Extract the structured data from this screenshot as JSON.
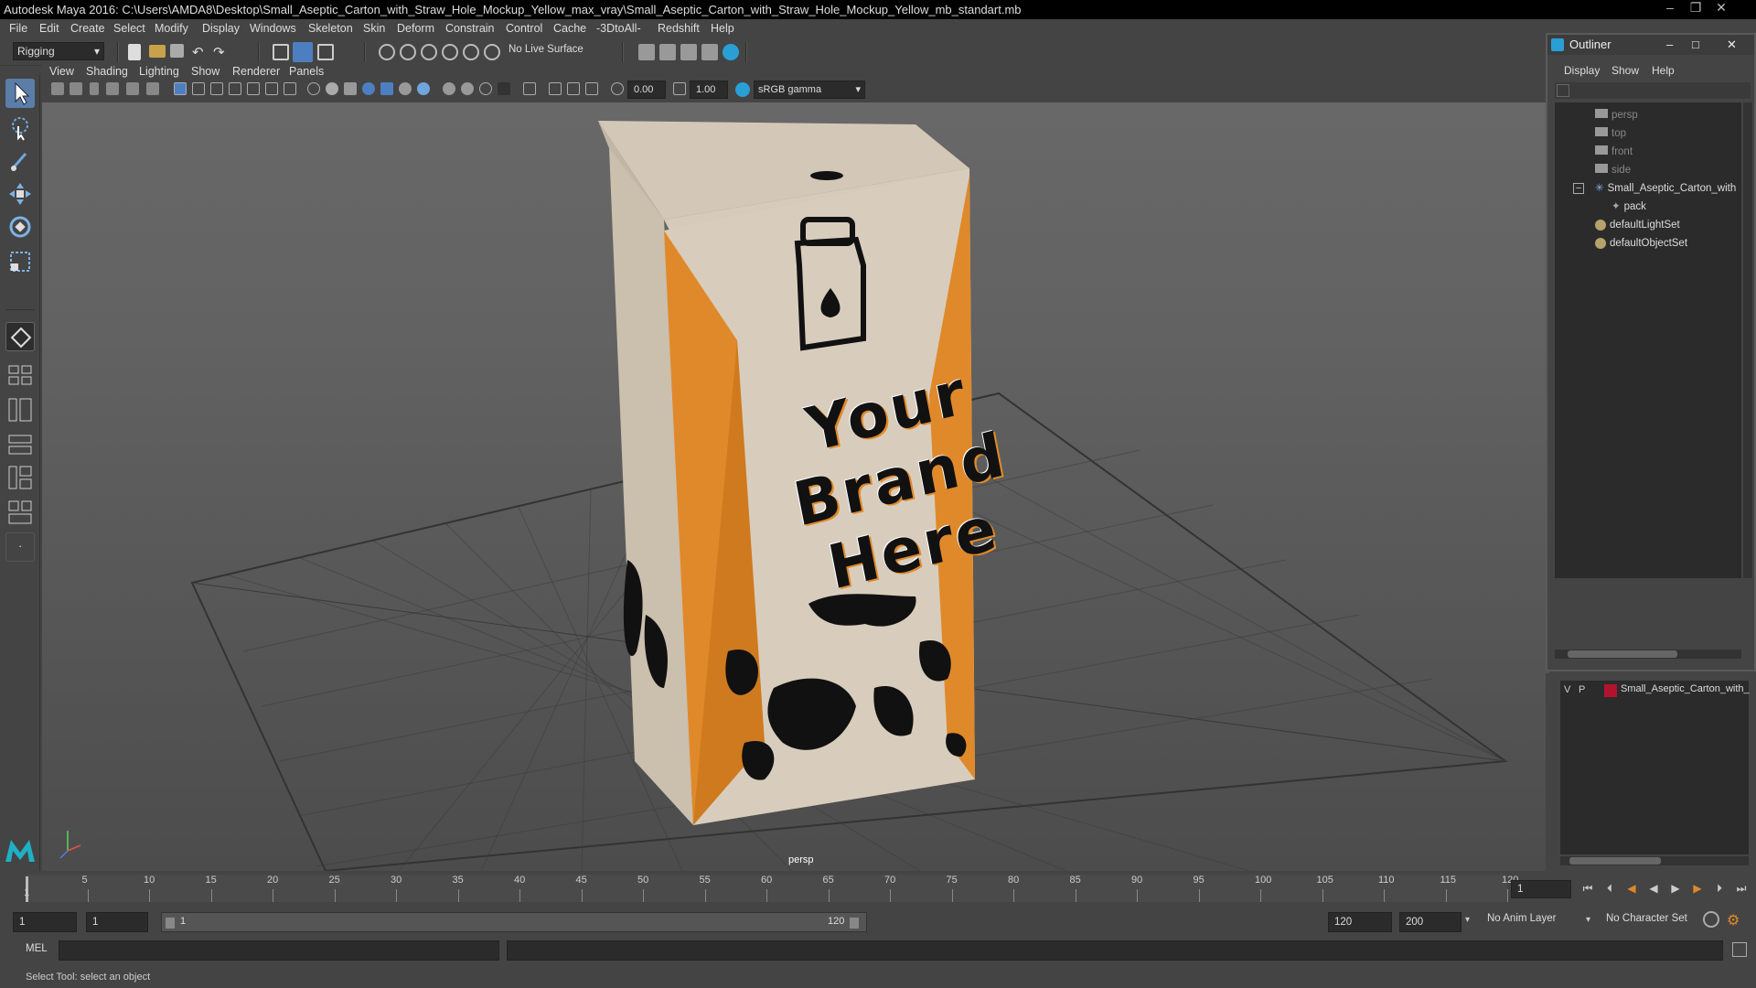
{
  "window": {
    "title": "Autodesk Maya 2016: C:\\Users\\AMDA8\\Desktop\\Small_Aseptic_Carton_with_Straw_Hole_Mockup_Yellow_max_vray\\Small_Aseptic_Carton_with_Straw_Hole_Mockup_Yellow_mb_standart.mb"
  },
  "menubar": {
    "items": [
      "File",
      "Edit",
      "Create",
      "Select",
      "Modify",
      "Display",
      "Windows",
      "Skeleton",
      "Skin",
      "Deform",
      "Constrain",
      "Control",
      "Cache",
      "-3DtoAll-",
      "Redshift",
      "Help"
    ]
  },
  "shelf": {
    "mode": "Rigging",
    "live_surface": "No Live Surface"
  },
  "panel_menu": {
    "items": [
      "View",
      "Shading",
      "Lighting",
      "Show",
      "Renderer",
      "Panels"
    ]
  },
  "panel_toolbar": {
    "exposure": "0.00",
    "gamma": "1.00",
    "color_space": "sRGB gamma"
  },
  "viewport": {
    "camera_label": "persp",
    "carton_text": [
      "Your",
      "Brand",
      "Here"
    ]
  },
  "outliner": {
    "title": "Outliner",
    "menu": [
      "Display",
      "Show",
      "Help"
    ],
    "items": [
      "persp",
      "top",
      "front",
      "side",
      "Small_Aseptic_Carton_with",
      "pack",
      "defaultLightSet",
      "defaultObjectSet"
    ]
  },
  "layer_editor": {
    "v": "V",
    "p": "P",
    "layer_name": "Small_Aseptic_Carton_with_"
  },
  "timeline": {
    "ticks": [
      "5",
      "10",
      "15",
      "20",
      "25",
      "30",
      "35",
      "40",
      "45",
      "50",
      "55",
      "60",
      "65",
      "70",
      "75",
      "80",
      "85",
      "90",
      "95",
      "100",
      "105",
      "110",
      "115",
      "120"
    ],
    "start_marker": "1",
    "current_frame": "1"
  },
  "range": {
    "start": "1",
    "playback_start": "1",
    "slider_start": "1",
    "slider_end": "120",
    "playback_end": "120",
    "end": "200",
    "anim_layer": "No Anim Layer",
    "character_set": "No Character Set"
  },
  "command": {
    "label": "MEL"
  },
  "help_line": {
    "text": "Select Tool: select an object"
  },
  "colors": {
    "bg": "#444444",
    "field": "#2b2b2b",
    "accent": "#4d7fc0",
    "carton_orange": "#e0892a",
    "carton_beige": "#d8cdbd",
    "layer_color": "#b3122e"
  }
}
